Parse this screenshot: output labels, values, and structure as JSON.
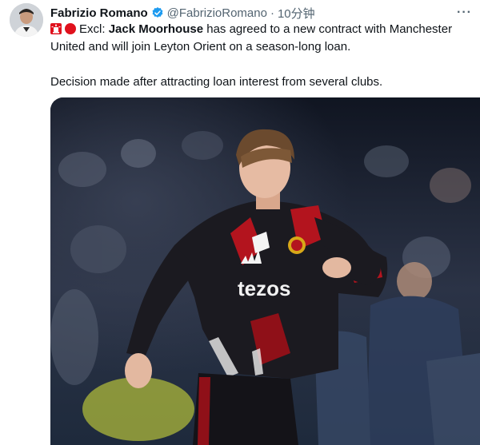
{
  "tweet": {
    "author_name": "Fabrizio Romano",
    "handle": "@FabrizioRomano",
    "separator": "·",
    "time": "10分钟",
    "more": "···",
    "text_prefix": "Excl: ",
    "text_bold": "Jack Moorhouse",
    "text_line1_rest": " has agreed to a new contract with Manchester United and will join Leyton Orient on a season-long loan.",
    "text_line2": "Decision made after attracting loan interest from several clubs."
  },
  "media": {
    "shirt_sponsor": "tezos"
  },
  "colors": {
    "verified": "#1d9bf0",
    "alarm_red": "#e0111d",
    "secondary_text": "#536471"
  }
}
